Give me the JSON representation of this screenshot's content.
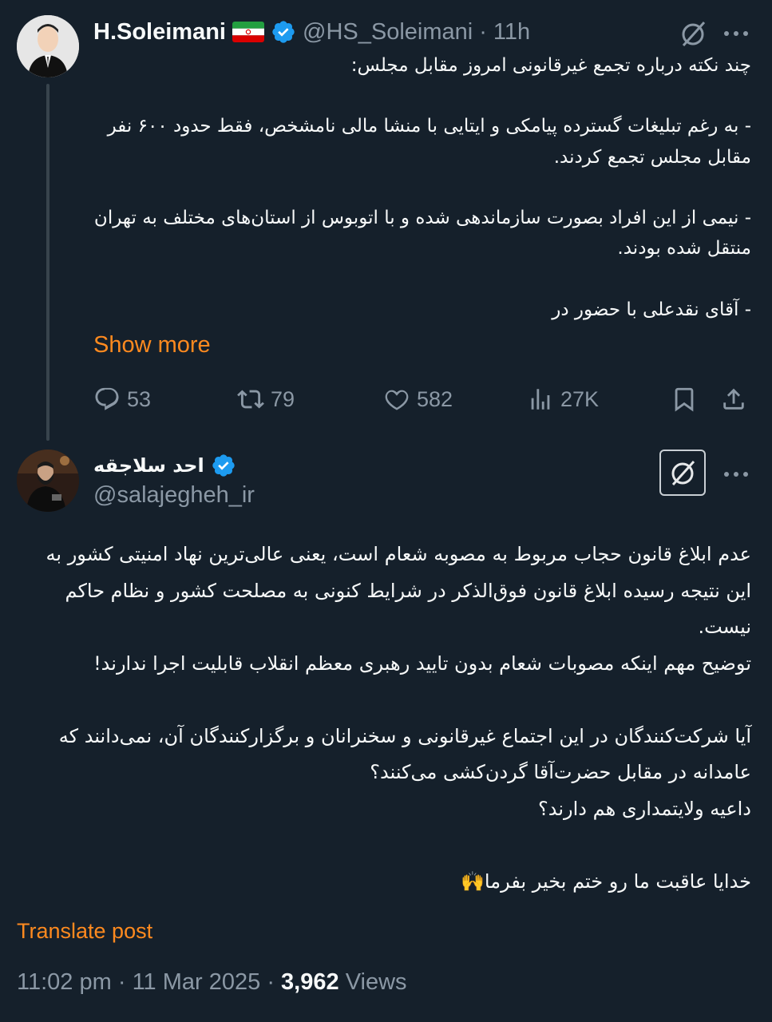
{
  "parent_tweet": {
    "author_name": "H.Soleimani",
    "author_handle": "@HS_Soleimani",
    "time_ago": "11h",
    "separator": "·",
    "text": "چند نکته درباره تجمع غیرقانونی امروز مقابل مجلس:\n\n- به رغم تبلیغات گسترده پیامکی و ایتایی با منشا مالی نامشخص، فقط حدود ۶۰۰ نفر مقابل مجلس تجمع کردند.\n\n- نیمی از این افراد بصورت سازماندهی شده و با اتوبوس از استان‌های مختلف به تهران منتقل شده بودند.\n\n- آقای نقدعلی با حضور در",
    "show_more_label": "Show more",
    "stats": {
      "replies": "53",
      "reposts": "79",
      "likes": "582",
      "views": "27K"
    },
    "icons": [
      "avatar",
      "iran-flag-icon",
      "verified-icon",
      "grok-icon",
      "more-icon",
      "reply-icon",
      "repost-icon",
      "like-icon",
      "views-icon",
      "bookmark-icon",
      "share-icon"
    ]
  },
  "main_tweet": {
    "author_name": "احد سلاجقه",
    "author_handle": "@salajegheh_ir",
    "text": "عدم ابلاغ قانون حجاب مربوط به مصوبه شعام است، یعنی عالی‌ترین نهاد امنیتی کشور به این نتیجه رسیده ابلاغ قانون فوق‌الذکر در شرایط کنونی به مصلحت کشور و نظام حاکم نیست.\nتوضیح مهم اینکه مصوبات شعام بدون تایید رهبری معظم انقلاب قابلیت اجرا ندارند!\n\nآیا شرکت‌کنندگان در این اجتماع غیرقانونی و سخنرانان و برگزارکنندگان آن، نمی‌دانند که  عامدانه در مقابل حضرت‌آقا گردن‌کشی می‌کنند؟\nداعیه ولایتمداری هم دارند؟\n\nخدایا عاقبت ما رو ختم بخیر بفرما🙌",
    "translate_label": "Translate post",
    "time": "11:02 pm",
    "date": "11 Mar 2025",
    "dot": "·",
    "views_count": "3,962",
    "views_label": "Views"
  },
  "colors": {
    "background": "#15202b",
    "text_primary": "#f7f9f9",
    "text_secondary": "#8b98a5",
    "accent": "#ff8a1f",
    "verified": "#1d9bf0",
    "thread_line": "#38444d"
  }
}
